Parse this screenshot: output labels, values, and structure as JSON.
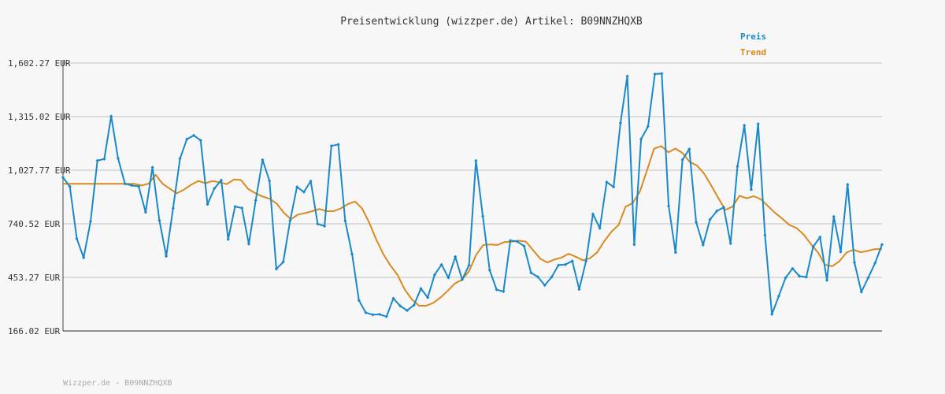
{
  "header": {
    "title": "Preisentwicklung (wizzper.de) Artikel: B09NNZHQXB"
  },
  "footer": {
    "text": "Wizzper.de - B09NNZHQXB"
  },
  "chart_data": {
    "type": "line",
    "title": "Preisentwicklung (wizzper.de) Artikel: B09NNZHQXB",
    "xlabel": "",
    "ylabel": "",
    "ylim": [
      166.02,
      1602.27
    ],
    "yticks": [
      "1,602.27 EUR",
      "1,315.02 EUR",
      "1,027.77 EUR",
      "740.52 EUR",
      "453.27 EUR",
      "166.02 EUR"
    ],
    "ytick_values": [
      1602.27,
      1315.02,
      1027.77,
      740.52,
      453.27,
      166.02
    ],
    "grid": true,
    "legend_position": "top-right",
    "series": [
      {
        "name": "Preis",
        "color": "#1a88c9",
        "values": [
          989,
          940,
          661,
          559,
          753,
          1079,
          1088,
          1317,
          1091,
          955,
          946,
          941,
          803,
          1043,
          759,
          567,
          824,
          1090,
          1194,
          1214,
          1188,
          845,
          930,
          974,
          657,
          833,
          825,
          632,
          866,
          1083,
          971,
          498,
          536,
          758,
          938,
          911,
          969,
          740,
          728,
          1158,
          1166,
          757,
          578,
          330,
          264,
          253,
          255,
          243,
          341,
          300,
          276,
          305,
          393,
          345,
          467,
          522,
          451,
          564,
          441,
          519,
          1079,
          781,
          492,
          388,
          377,
          651,
          646,
          621,
          478,
          456,
          411,
          455,
          519,
          522,
          541,
          389,
          541,
          793,
          717,
          964,
          938,
          1281,
          1532,
          629,
          1195,
          1262,
          1543,
          1546,
          836,
          587,
          1083,
          1141,
          749,
          627,
          763,
          809,
          829,
          635,
          1048,
          1268,
          924,
          1276,
          680,
          255,
          353,
          451,
          501,
          460,
          455,
          617,
          669,
          438,
          779,
          590,
          951,
          533,
          375,
          451,
          531,
          629
        ],
        "smooth": false
      },
      {
        "name": "Trend",
        "color": "#d98a1f",
        "values": [
          955,
          955,
          955,
          955,
          955,
          955,
          955,
          955,
          955,
          955,
          955,
          946,
          955,
          1003,
          955,
          928,
          904,
          924,
          950,
          970,
          958,
          970,
          963,
          953,
          978,
          975,
          927,
          905,
          887,
          875,
          849,
          800,
          765,
          790,
          798,
          808,
          820,
          808,
          808,
          823,
          846,
          860,
          823,
          746,
          655,
          576,
          516,
          465,
          387,
          335,
          301,
          301,
          317,
          345,
          380,
          420,
          440,
          486,
          573,
          627,
          630,
          627,
          643,
          644,
          650,
          645,
          599,
          554,
          533,
          549,
          559,
          580,
          564,
          545,
          556,
          587,
          647,
          698,
          733,
          832,
          852,
          913,
          1027,
          1143,
          1157,
          1124,
          1144,
          1119,
          1072,
          1053,
          1011,
          947,
          880,
          815,
          832,
          891,
          877,
          889,
          871,
          835,
          799,
          768,
          734,
          718,
          683,
          633,
          587,
          521,
          513,
          539,
          586,
          601,
          588,
          595,
          605,
          605
        ],
        "smooth": true
      }
    ]
  }
}
